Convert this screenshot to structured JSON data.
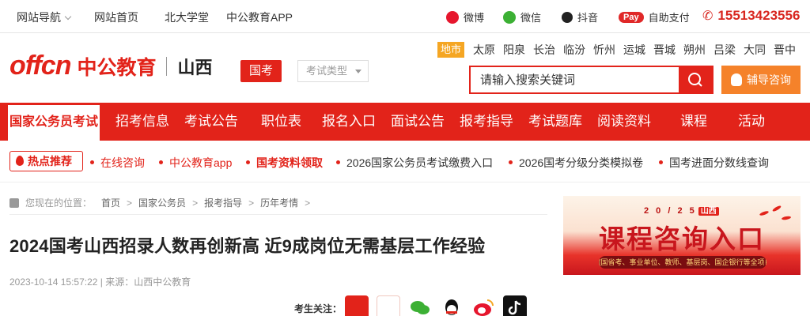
{
  "topbar": {
    "site_nav": "网站导航",
    "home": "网站首页",
    "pku": "北大学堂",
    "app": "中公教育APP",
    "weibo": "微博",
    "wechat": "微信",
    "douyin": "抖音",
    "pay_badge": "Pay",
    "self_pay": "自助支付",
    "phone": "15513423556"
  },
  "header": {
    "logo_en": "offcn",
    "logo_cn": "中公教育",
    "region": "山西",
    "exam_tag": "国考",
    "exam_type_placeholder": "考试类型",
    "city_label": "地市",
    "cities": [
      "太原",
      "阳泉",
      "长治",
      "临汾",
      "忻州",
      "运城",
      "晋城",
      "朔州",
      "吕梁",
      "大同",
      "晋中"
    ],
    "search_placeholder": "请输入搜索关键词",
    "consult_label": "辅导咨询"
  },
  "nav": {
    "items": [
      "国家公务员考试",
      "招考信息",
      "考试公告",
      "职位表",
      "报名入口",
      "面试公告",
      "报考指导",
      "考试题库",
      "阅读资料",
      "课程",
      "活动"
    ]
  },
  "hot": {
    "label": "热点推荐",
    "links": [
      "在线咨询",
      "中公教育app",
      "国考资料领取",
      "2026国家公务员考试缴费入口",
      "2026国考分级分类模拟卷",
      "国考进面分数线查询"
    ]
  },
  "breadcrumb": {
    "label": "您现在的位置：",
    "items": [
      "首页",
      "国家公务员",
      "报考指导",
      "历年考情"
    ]
  },
  "article": {
    "title": "2024国考山西招录人数再创新高 近9成岗位无需基层工作经验",
    "meta": "2023-10-14 15:57:22 | 来源：山西中公教育",
    "follow_label": "考生关注："
  },
  "banner": {
    "date": "2 0 / 2 5",
    "loc": "山西",
    "heading": "课程咨询入口",
    "sub": "[国省考、事业单位、教师、基层岗、国企银行等全项目课程]"
  },
  "colors": {
    "brand_red": "#e2231a",
    "accent_orange": "#f5822a",
    "city_badge": "#f5a623"
  }
}
